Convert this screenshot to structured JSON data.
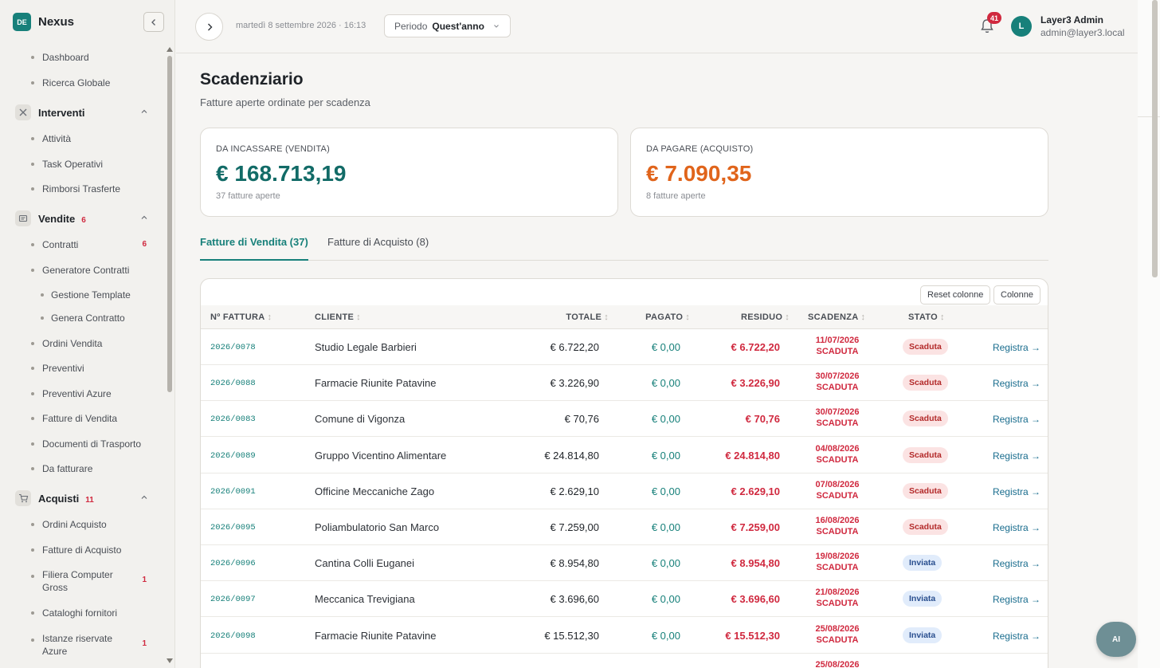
{
  "brand": {
    "badge": "DE",
    "name": "Nexus"
  },
  "sidebar": {
    "items": [
      {
        "type": "item",
        "label": "Dashboard"
      },
      {
        "type": "item",
        "label": "Ricerca Globale"
      },
      {
        "type": "section",
        "label": "Interventi",
        "icon": "tools-icon"
      },
      {
        "type": "item",
        "label": "Attività"
      },
      {
        "type": "item",
        "label": "Task Operativi"
      },
      {
        "type": "item",
        "label": "Rimborsi Trasferte"
      },
      {
        "type": "section",
        "label": "Vendite",
        "count": "6",
        "icon": "receipt-icon"
      },
      {
        "type": "item",
        "label": "Contratti",
        "count": "6"
      },
      {
        "type": "item",
        "label": "Generatore Contratti"
      },
      {
        "type": "sub",
        "label": "Gestione Template"
      },
      {
        "type": "sub",
        "label": "Genera Contratto"
      },
      {
        "type": "item",
        "label": "Ordini Vendita"
      },
      {
        "type": "item",
        "label": "Preventivi"
      },
      {
        "type": "item",
        "label": "Preventivi Azure"
      },
      {
        "type": "item",
        "label": "Fatture di Vendita"
      },
      {
        "type": "item",
        "label": "Documenti di Trasporto"
      },
      {
        "type": "item",
        "label": "Da fatturare"
      },
      {
        "type": "section",
        "label": "Acquisti",
        "count": "11",
        "icon": "cart-icon"
      },
      {
        "type": "item",
        "label": "Ordini Acquisto"
      },
      {
        "type": "item",
        "label": "Fatture di Acquisto"
      },
      {
        "type": "item2",
        "label": "Filiera Computer",
        "label2": "Gross",
        "count": "1"
      },
      {
        "type": "item",
        "label": "Cataloghi fornitori"
      },
      {
        "type": "item2",
        "label": "Istanze riservate",
        "label2": "Azure",
        "count": "1"
      }
    ]
  },
  "header": {
    "datetime": "martedì 8 settembre 2026 · 16:13",
    "period_label": "Periodo",
    "period_value": "Quest'anno",
    "notifications": "41",
    "avatar": "L",
    "user_name": "Layer3 Admin",
    "user_email": "admin@layer3.local"
  },
  "page": {
    "title": "Scadenziario",
    "subtitle": "Fatture aperte ordinate per scadenza"
  },
  "cards": {
    "sales": {
      "label": "DA INCASSARE (VENDITA)",
      "value": "€ 168.713,19",
      "note": "37 fatture aperte",
      "color": "#126b67"
    },
    "purchase": {
      "label": "DA PAGARE (ACQUISTO)",
      "value": "€ 7.090,35",
      "note": "8 fatture aperte",
      "color": "#e0641b"
    }
  },
  "tabs": {
    "sales": "Fatture di Vendita (37)",
    "purchase": "Fatture di Acquisto (8)"
  },
  "table": {
    "reset_label": "Reset colonne",
    "columns_label": "Colonne",
    "headers": [
      "Nº FATTURA",
      "CLIENTE",
      "TOTALE",
      "PAGATO",
      "RESIDUO",
      "SCADENZA",
      "STATO"
    ],
    "sort_glyph": "↕",
    "rows": [
      {
        "num": "2026/0078",
        "cliente": "Studio Legale Barbieri",
        "totale": "€ 6.722,20",
        "pagato": "€ 0,00",
        "residuo": "€ 6.722,20",
        "scad_date": "11/07/2026",
        "scad_flag": "SCADUTA",
        "stato": "Scaduta",
        "action": "Registra →"
      },
      {
        "num": "2026/0088",
        "cliente": "Farmacie Riunite Patavine",
        "totale": "€ 3.226,90",
        "pagato": "€ 0,00",
        "residuo": "€ 3.226,90",
        "scad_date": "30/07/2026",
        "scad_flag": "SCADUTA",
        "stato": "Scaduta",
        "action": "Registra →"
      },
      {
        "num": "2026/0083",
        "cliente": "Comune di Vigonza",
        "totale": "€ 70,76",
        "pagato": "€ 0,00",
        "residuo": "€ 70,76",
        "scad_date": "30/07/2026",
        "scad_flag": "SCADUTA",
        "stato": "Scaduta",
        "action": "Registra →"
      },
      {
        "num": "2026/0089",
        "cliente": "Gruppo Vicentino Alimentare",
        "totale": "€ 24.814,80",
        "pagato": "€ 0,00",
        "residuo": "€ 24.814,80",
        "scad_date": "04/08/2026",
        "scad_flag": "SCADUTA",
        "stato": "Scaduta",
        "action": "Registra →"
      },
      {
        "num": "2026/0091",
        "cliente": "Officine Meccaniche Zago",
        "totale": "€ 2.629,10",
        "pagato": "€ 0,00",
        "residuo": "€ 2.629,10",
        "scad_date": "07/08/2026",
        "scad_flag": "SCADUTA",
        "stato": "Scaduta",
        "action": "Registra →"
      },
      {
        "num": "2026/0095",
        "cliente": "Poliambulatorio San Marco",
        "totale": "€ 7.259,00",
        "pagato": "€ 0,00",
        "residuo": "€ 7.259,00",
        "scad_date": "16/08/2026",
        "scad_flag": "SCADUTA",
        "stato": "Scaduta",
        "action": "Registra →"
      },
      {
        "num": "2026/0096",
        "cliente": "Cantina Colli Euganei",
        "totale": "€ 8.954,80",
        "pagato": "€ 0,00",
        "residuo": "€ 8.954,80",
        "scad_date": "19/08/2026",
        "scad_flag": "SCADUTA",
        "stato": "Inviata",
        "action": "Registra →"
      },
      {
        "num": "2026/0097",
        "cliente": "Meccanica Trevigiana",
        "totale": "€ 3.696,60",
        "pagato": "€ 0,00",
        "residuo": "€ 3.696,60",
        "scad_date": "21/08/2026",
        "scad_flag": "SCADUTA",
        "stato": "Inviata",
        "action": "Registra →"
      },
      {
        "num": "2026/0098",
        "cliente": "Farmacie Riunite Patavine",
        "totale": "€ 15.512,30",
        "pagato": "€ 0,00",
        "residuo": "€ 15.512,30",
        "scad_date": "25/08/2026",
        "scad_flag": "SCADUTA",
        "stato": "Inviata",
        "action": "Registra →"
      },
      {
        "num": "",
        "cliente": "",
        "totale": "",
        "pagato": "",
        "residuo": "",
        "scad_date": "25/08/2026",
        "scad_flag": "",
        "stato": "",
        "action": ""
      }
    ]
  },
  "ai_button": "AI"
}
